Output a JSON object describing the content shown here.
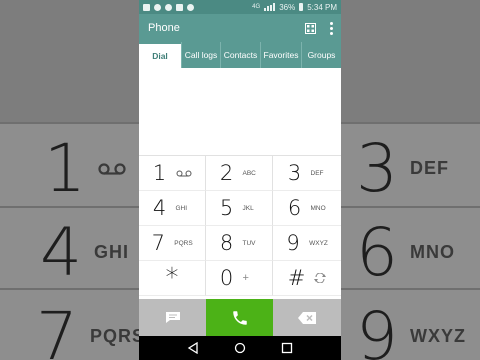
{
  "status_bar": {
    "battery": "36%",
    "time": "5:34 PM",
    "network": "4G"
  },
  "app_bar": {
    "title": "Phone"
  },
  "tabs": [
    {
      "label": "Dial",
      "active": true
    },
    {
      "label": "Call logs",
      "active": false
    },
    {
      "label": "Contacts",
      "active": false
    },
    {
      "label": "Favorites",
      "active": false
    },
    {
      "label": "Groups",
      "active": false
    }
  ],
  "keypad": [
    {
      "digit": "1",
      "letters": "voicemail-icon"
    },
    {
      "digit": "2",
      "letters": "ABC"
    },
    {
      "digit": "3",
      "letters": "DEF"
    },
    {
      "digit": "4",
      "letters": "GHI"
    },
    {
      "digit": "5",
      "letters": "JKL"
    },
    {
      "digit": "6",
      "letters": "MNO"
    },
    {
      "digit": "7",
      "letters": "PQRS"
    },
    {
      "digit": "8",
      "letters": "TUV"
    },
    {
      "digit": "9",
      "letters": "WXYZ"
    },
    {
      "digit": "*",
      "letters": ""
    },
    {
      "digit": "0",
      "letters": "+"
    },
    {
      "digit": "#",
      "letters": "swap-icon"
    }
  ],
  "background_keys": [
    {
      "digit": "1",
      "letters": ""
    },
    {
      "digit": "3",
      "letters": "DEF"
    },
    {
      "digit": "4",
      "letters": "GHI"
    },
    {
      "digit": "6",
      "letters": "MNO"
    },
    {
      "digit": "7",
      "letters": "PQRS"
    },
    {
      "digit": "9",
      "letters": "WXYZ"
    }
  ],
  "colors": {
    "accent": "#5a9a93",
    "status_bar": "#4b8a83",
    "call_button": "#4cb217",
    "side_buttons": "#bcbcbc"
  },
  "icons": {
    "message": "message-icon",
    "call": "phone-call-icon",
    "delete": "backspace-icon",
    "speed_dial": "speed-dial-grid-icon",
    "menu": "overflow-menu-icon",
    "nav_back": "nav-back-icon",
    "nav_home": "nav-home-icon",
    "nav_recent": "nav-recent-icon"
  }
}
